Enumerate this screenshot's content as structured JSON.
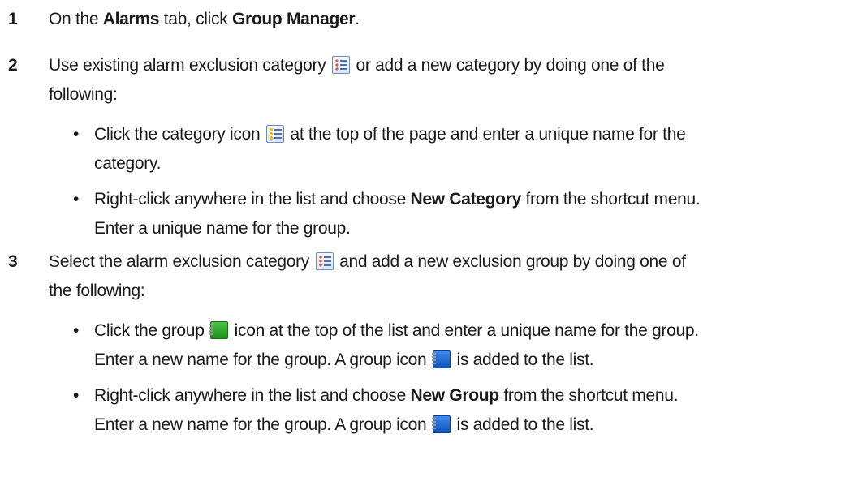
{
  "steps": [
    {
      "number": "1",
      "text": {
        "a": "On the ",
        "b_bold": "Alarms",
        "c": " tab, click ",
        "d_bold": "Group Manager",
        "e": "."
      }
    },
    {
      "number": "2",
      "text": {
        "line1_a": "Use existing alarm exclusion category ",
        "line1_b": " or add a new category by doing one of the",
        "line2": "following:"
      },
      "bullets": [
        {
          "line1_a": "Click the category icon ",
          "line1_b": " at the top of the page and enter a unique name for the",
          "line2": "category."
        },
        {
          "line1_a": "Right-click anywhere in the list and choose ",
          "line1_bold": "New Category",
          "line1_b": " from the shortcut menu.",
          "line2": "Enter a unique name for the group."
        }
      ]
    },
    {
      "number": "3",
      "text": {
        "line1_a": "Select the alarm exclusion category ",
        "line1_b": " and add a new exclusion group by doing one of",
        "line2": "the following:"
      },
      "bullets": [
        {
          "line1_a": "Click the group ",
          "line1_b": " icon at the top of the list and enter a unique name for the group.",
          "line2_a": "Enter a new name for the group. A group icon ",
          "line2_b": " is added to the list."
        },
        {
          "line1_a": "Right-click anywhere in the list and choose ",
          "line1_bold": "New Group",
          "line1_b": " from the shortcut menu.",
          "line2_a": "Enter a new name for the group. A group icon ",
          "line2_b": " is added to the list."
        }
      ]
    }
  ],
  "bullet_glyph": "•",
  "icons": {
    "category": "alarm-exclusion-category-icon",
    "new_category": "new-category-icon",
    "new_group": "new-group-icon",
    "group": "group-icon"
  }
}
